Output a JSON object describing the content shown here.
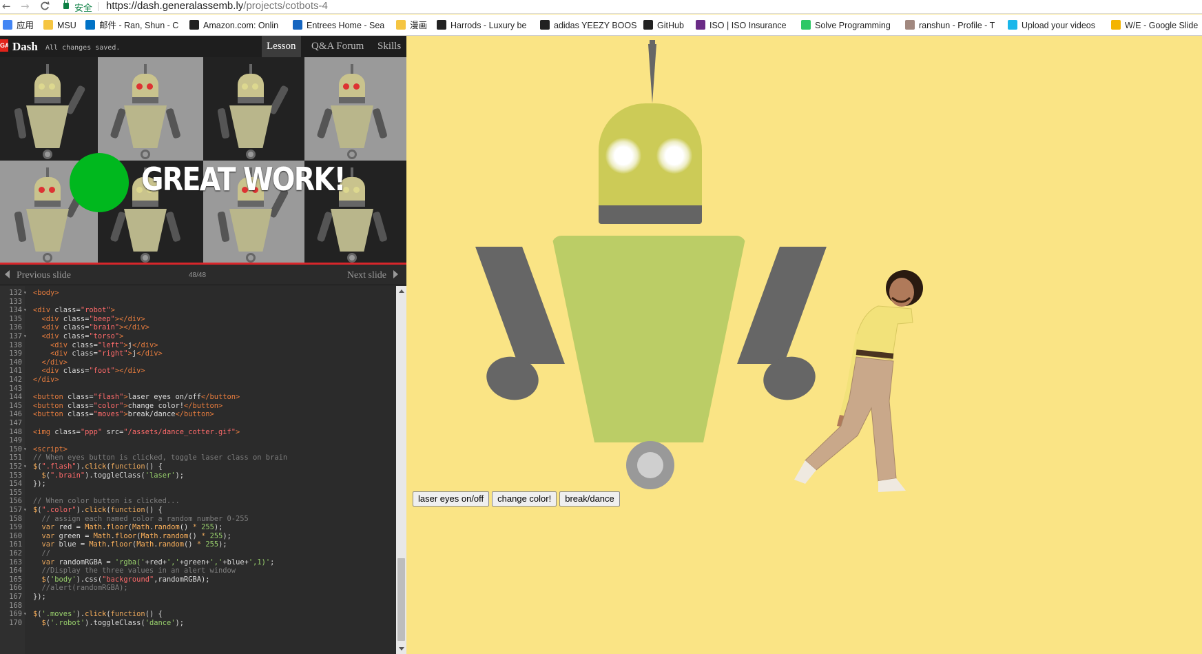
{
  "browser": {
    "nav_back": "←",
    "nav_forward": "→",
    "nav_reload": "C",
    "secure_label": "安全",
    "url_main": "https://dash.generalassemb.ly",
    "url_path": "/projects/cotbots-4",
    "bookmarks": [
      {
        "label": "应用",
        "icon": "apps-grid-icon",
        "color": "#4285f4"
      },
      {
        "label": "MSU",
        "icon": "folder-icon",
        "color": "#f5c542"
      },
      {
        "label": "邮件 - Ran, Shun - C",
        "icon": "outlook-icon",
        "color": "#0072c6"
      },
      {
        "label": "Amazon.com: Onlin",
        "icon": "amazon-icon",
        "color": "#222222"
      },
      {
        "label": "Entrees Home - Sea",
        "icon": "dominos-icon",
        "color": "#1565c0"
      },
      {
        "label": "漫画",
        "icon": "folder-icon",
        "color": "#f5c542"
      },
      {
        "label": "Harrods - Luxury be",
        "icon": "harrods-icon",
        "color": "#222222"
      },
      {
        "label": "adidas YEEZY BOOS",
        "icon": "adidas-icon",
        "color": "#222222"
      },
      {
        "label": "GitHub",
        "icon": "github-icon",
        "color": "#222222"
      },
      {
        "label": "ISO | ISO Insurance",
        "icon": "iso-icon",
        "color": "#6a2b86"
      },
      {
        "label": "Solve Programming",
        "icon": "hackerrank-icon",
        "color": "#2ec866"
      },
      {
        "label": "ranshun - Profile - T",
        "icon": "profile-icon",
        "color": "#a1887f"
      },
      {
        "label": "Upload your videos",
        "icon": "vimeo-icon",
        "color": "#1ab7ea"
      },
      {
        "label": "W/E - Google Slide",
        "icon": "slides-icon",
        "color": "#f4b400"
      }
    ]
  },
  "dash": {
    "logo": "GA",
    "title": "Dash",
    "status": "All changes saved.",
    "tabs": [
      "Lesson",
      "Q&A Forum",
      "Skills"
    ],
    "slide_banner": "GREAT WORK!",
    "prev_label": "Previous slide",
    "next_label": "Next slide",
    "slide_count": "48/48"
  },
  "code_lines": [
    {
      "n": "132",
      "fold": true,
      "html": "<span class='tag'>&lt;body&gt;</span>"
    },
    {
      "n": "133",
      "html": ""
    },
    {
      "n": "134",
      "fold": true,
      "html": "<span class='tag'>&lt;div </span><span class='attr'>class=</span><span class='str'>\"robot\"</span><span class='tag'>&gt;</span>"
    },
    {
      "n": "135",
      "html": "  <span class='tag'>&lt;div </span><span class='attr'>class=</span><span class='str'>\"beep\"</span><span class='tag'>&gt;&lt;/div&gt;</span>"
    },
    {
      "n": "136",
      "html": "  <span class='tag'>&lt;div </span><span class='attr'>class=</span><span class='str'>\"brain\"</span><span class='tag'>&gt;&lt;/div&gt;</span>"
    },
    {
      "n": "137",
      "fold": true,
      "html": "  <span class='tag'>&lt;div </span><span class='attr'>class=</span><span class='str'>\"torso\"</span><span class='tag'>&gt;</span>"
    },
    {
      "n": "138",
      "html": "    <span class='tag'>&lt;div </span><span class='attr'>class=</span><span class='str'>\"left\"</span><span class='tag'>&gt;</span>j<span class='tag'>&lt;/div&gt;</span>"
    },
    {
      "n": "139",
      "html": "    <span class='tag'>&lt;div </span><span class='attr'>class=</span><span class='str'>\"right\"</span><span class='tag'>&gt;</span>j<span class='tag'>&lt;/div&gt;</span>"
    },
    {
      "n": "140",
      "html": "  <span class='tag'>&lt;/div&gt;</span>"
    },
    {
      "n": "141",
      "html": "  <span class='tag'>&lt;div </span><span class='attr'>class=</span><span class='str'>\"foot\"</span><span class='tag'>&gt;&lt;/div&gt;</span>"
    },
    {
      "n": "142",
      "html": "<span class='tag'>&lt;/div&gt;</span>"
    },
    {
      "n": "143",
      "html": ""
    },
    {
      "n": "144",
      "html": "<span class='tag'>&lt;button </span><span class='attr'>class=</span><span class='str'>\"flash\"</span><span class='tag'>&gt;</span>laser eyes on/off<span class='tag'>&lt;/button&gt;</span>"
    },
    {
      "n": "145",
      "html": "<span class='tag'>&lt;button </span><span class='attr'>class=</span><span class='str'>\"color\"</span><span class='tag'>&gt;</span>change color!<span class='tag'>&lt;/button&gt;</span>"
    },
    {
      "n": "146",
      "html": "<span class='tag'>&lt;button </span><span class='attr'>class=</span><span class='str'>\"moves\"</span><span class='tag'>&gt;</span>break/dance<span class='tag'>&lt;/button&gt;</span>"
    },
    {
      "n": "147",
      "html": ""
    },
    {
      "n": "148",
      "html": "<span class='tag'>&lt;img </span><span class='attr'>class=</span><span class='str'>\"ppp\"</span><span class='attr'> src=</span><span class='str'>\"/assets/dance_cotter.gif\"</span><span class='tag'>&gt;</span>"
    },
    {
      "n": "149",
      "html": ""
    },
    {
      "n": "150",
      "fold": true,
      "html": "<span class='tag'>&lt;script&gt;</span>"
    },
    {
      "n": "151",
      "html": "<span class='cm'>// When eyes button is clicked, toggle laser class on brain</span>"
    },
    {
      "n": "152",
      "fold": true,
      "html": "<span class='fn'>$</span>(<span class='str'>\".flash\"</span>).<span class='fn'>click</span>(<span class='kw'>function</span>() {"
    },
    {
      "n": "153",
      "html": "  <span class='fn'>$</span>(<span class='str'>\".brain\"</span>).toggleClass(<span class='grn'>'laser'</span>);"
    },
    {
      "n": "154",
      "html": "});"
    },
    {
      "n": "155",
      "html": ""
    },
    {
      "n": "156",
      "html": "<span class='cm'>// When color button is clicked...</span>"
    },
    {
      "n": "157",
      "fold": true,
      "html": "<span class='fn'>$</span>(<span class='str'>\".color\"</span>).<span class='fn'>click</span>(<span class='kw'>function</span>() {"
    },
    {
      "n": "158",
      "html": "  <span class='cm'>// assign each named color a random number 0-255</span>"
    },
    {
      "n": "159",
      "html": "  <span class='kw'>var</span> red = <span class='fn'>Math</span>.<span class='fn'>floor</span>(<span class='fn'>Math</span>.<span class='fn'>random</span>() <span class='kw'>*</span> <span class='num'>255</span>);"
    },
    {
      "n": "160",
      "html": "  <span class='kw'>var</span> green = <span class='fn'>Math</span>.<span class='fn'>floor</span>(<span class='fn'>Math</span>.<span class='fn'>random</span>() <span class='kw'>*</span> <span class='num'>255</span>);"
    },
    {
      "n": "161",
      "html": "  <span class='kw'>var</span> blue = <span class='fn'>Math</span>.<span class='fn'>floor</span>(<span class='fn'>Math</span>.<span class='fn'>random</span>() <span class='kw'>*</span> <span class='num'>255</span>);"
    },
    {
      "n": "162",
      "html": "  <span class='cm'>//</span>"
    },
    {
      "n": "163",
      "html": "  <span class='kw'>var</span> randomRGBA = <span class='grn'>'rgba('</span>+red+<span class='grn'>','</span>+green+<span class='grn'>','</span>+blue+<span class='grn'>',1)'</span>;"
    },
    {
      "n": "164",
      "html": "  <span class='cm'>//Display the three values in an alert window</span>"
    },
    {
      "n": "165",
      "html": "  <span class='fn'>$</span>(<span class='grn'>'body'</span>).css(<span class='str'>\"background\"</span>,randomRGBA);"
    },
    {
      "n": "166",
      "html": "  <span class='cm'>//alert(randomRGBA);</span>"
    },
    {
      "n": "167",
      "html": "});"
    },
    {
      "n": "168",
      "html": ""
    },
    {
      "n": "169",
      "fold": true,
      "html": "<span class='fn'>$</span>(<span class='grn'>'.moves'</span>).<span class='fn'>click</span>(<span class='kw'>function</span>() {"
    },
    {
      "n": "170",
      "html": "  <span class='fn'>$</span>(<span class='grn'>'.robot'</span>).toggleClass(<span class='grn'>'dance'</span>);"
    }
  ],
  "stage": {
    "background": "#fae485",
    "buttons": {
      "flash": "laser eyes on/off",
      "color": "change color!",
      "moves": "break/dance"
    }
  }
}
